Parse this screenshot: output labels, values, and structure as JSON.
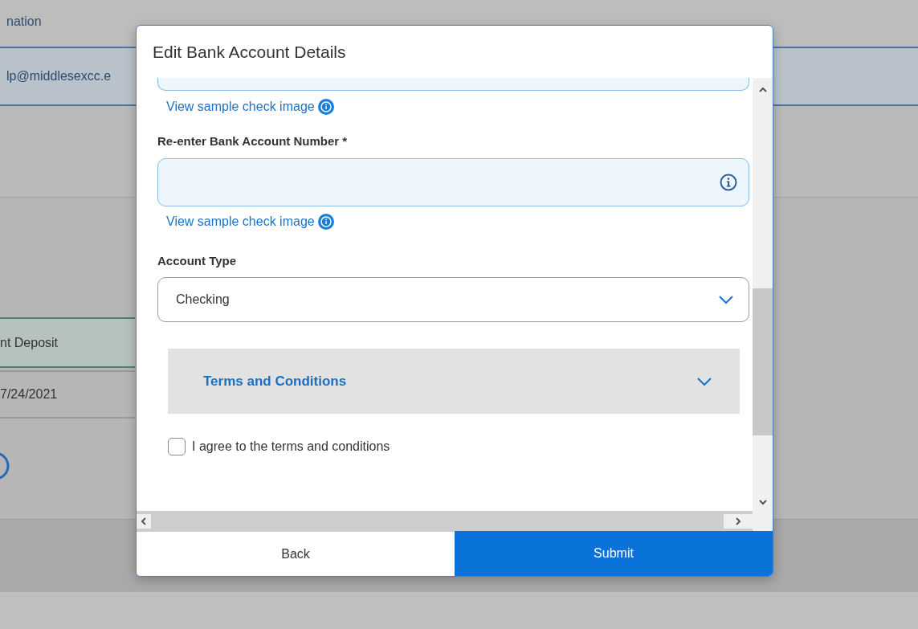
{
  "background": {
    "header": "nation",
    "email": "lp@middlesexcc.e",
    "tab": "nt Deposit",
    "date": "7/24/2021"
  },
  "dialog": {
    "title": "Edit Bank Account Details",
    "account_number": {
      "link": "View sample check image"
    },
    "reenter": {
      "label": "Re-enter Bank Account Number *",
      "link": "View sample check image"
    },
    "account_type": {
      "label": "Account Type",
      "value": "Checking"
    },
    "terms": {
      "title": "Terms and Conditions",
      "expanded": false
    },
    "agree": {
      "label": "I agree to the terms and conditions",
      "checked": false
    },
    "buttons": [
      {
        "label": "Back",
        "kind": "secondary"
      },
      {
        "label": "Submit",
        "kind": "primary"
      }
    ]
  }
}
